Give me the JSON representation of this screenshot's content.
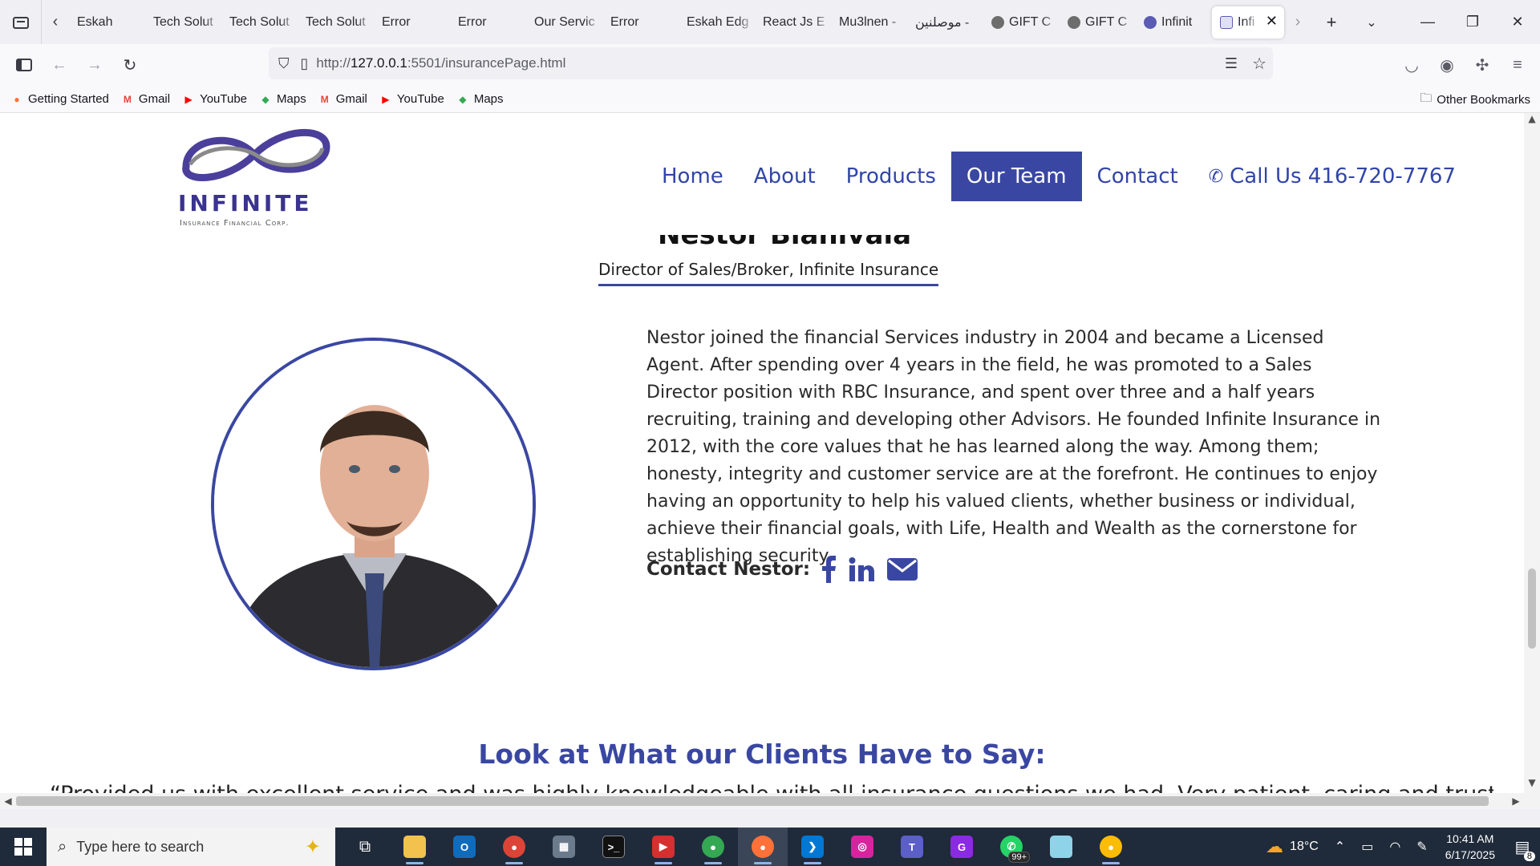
{
  "browser": {
    "tabs": [
      {
        "label": "Eskah",
        "favicon_color": "#bdbdbd"
      },
      {
        "label": "Tech Solut",
        "favicon_color": "#bdbdbd"
      },
      {
        "label": "Tech Solut",
        "favicon_color": "#bdbdbd"
      },
      {
        "label": "Tech Solut",
        "favicon_color": "#bdbdbd"
      },
      {
        "label": "Error",
        "favicon_color": "#bdbdbd"
      },
      {
        "label": "Error",
        "favicon_color": "#bdbdbd"
      },
      {
        "label": "Our Servic",
        "favicon_color": "#bdbdbd"
      },
      {
        "label": "Error",
        "favicon_color": "#bdbdbd"
      },
      {
        "label": "Eskah Edg",
        "favicon_color": "#bdbdbd"
      },
      {
        "label": "React Js E",
        "favicon_color": "#bdbdbd"
      },
      {
        "label": "Mu3lnen -",
        "favicon_color": "#bdbdbd"
      },
      {
        "label": "موصلنين -",
        "favicon_color": "#bdbdbd"
      },
      {
        "label": "GIFT C",
        "favicon_color": "#6d6d6d"
      },
      {
        "label": "GIFT C",
        "favicon_color": "#6d6d6d"
      },
      {
        "label": "Infinit",
        "favicon_color": "#5b5bb5"
      }
    ],
    "active_tab": {
      "label": "Infi",
      "close_icon": "close-icon"
    },
    "url_prefix": "http://",
    "url_host": "127.0.0.1",
    "url_rest": ":5501/insurancePage.html",
    "bookmarks": [
      {
        "label": "Getting Started",
        "icon": "firefox-icon"
      },
      {
        "label": "Gmail",
        "icon": "gmail-icon"
      },
      {
        "label": "YouTube",
        "icon": "youtube-icon"
      },
      {
        "label": "Maps",
        "icon": "maps-icon"
      },
      {
        "label": "Gmail",
        "icon": "gmail-icon"
      },
      {
        "label": "YouTube",
        "icon": "youtube-icon"
      },
      {
        "label": "Maps",
        "icon": "maps-icon"
      }
    ],
    "other_bookmarks": "Other Bookmarks"
  },
  "site": {
    "logo_name": "INFINITE",
    "logo_sub": "Insurance Financial Corp.",
    "nav": [
      "Home",
      "About",
      "Products",
      "Our Team",
      "Contact"
    ],
    "nav_active": "Our Team",
    "call_label": "Call Us 416-720-7767",
    "accent": "#3a47a2"
  },
  "member": {
    "name_peek": "Nestor Bianivala",
    "role": "Director of Sales/Broker, Infinite Insurance",
    "bio": "Nestor joined the financial Services industry in 2004 and became a Licensed Agent. After spending over 4 years in the field, he was promoted to a Sales Director position with RBC Insurance, and spent over three and a half years recruiting, training and developing other Advisors. He founded Infinite Insurance in 2012, with the core values that he has learned along the way. Among them; honesty, integrity and customer service are at the forefront. He continues to enjoy having an opportunity to help his valued clients, whether business or individual, achieve their financial goals, with Life, Health and Wealth as the cornerstone for establishing security.",
    "contact_label": "Contact Nestor:"
  },
  "testimonials": {
    "title": "Look at What our Clients Have to Say:",
    "first_quote": "“Provided us with excellent service and was highly knowledgeable with all insurance questions we had. Very patient, caring and trustworthy. Will"
  },
  "taskbar": {
    "search_placeholder": "Type here to search",
    "whatsapp_badge": "99+",
    "temperature": "18°C",
    "time": "10:41 AM",
    "date": "6/17/2025",
    "notification_count": "8"
  }
}
